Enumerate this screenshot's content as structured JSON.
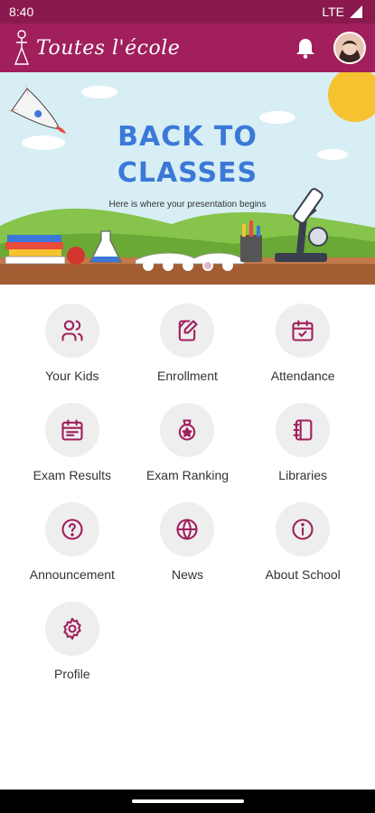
{
  "status": {
    "time": "8:40",
    "network": "LTE"
  },
  "app": {
    "logo_text": "Toutes l'école",
    "brand_color": "#a01f5c",
    "status_color": "#8a1a4e",
    "icon_color": "#a01f5c"
  },
  "banner": {
    "title_line1": "BACK TO",
    "title_line2": "CLASSES",
    "subtitle": "Here is where your presentation begins",
    "dot_count": 5,
    "active_dot": 4
  },
  "menu": [
    {
      "label": "Your Kids",
      "icon": "users-icon"
    },
    {
      "label": "Enrollment",
      "icon": "edit-document-icon"
    },
    {
      "label": "Attendance",
      "icon": "calendar-check-icon"
    },
    {
      "label": "Exam Results",
      "icon": "calendar-list-icon"
    },
    {
      "label": "Exam Ranking",
      "icon": "medal-icon"
    },
    {
      "label": "Libraries",
      "icon": "notebook-icon"
    },
    {
      "label": "Announcement",
      "icon": "help-circle-icon"
    },
    {
      "label": "News",
      "icon": "globe-icon"
    },
    {
      "label": "About School",
      "icon": "info-circle-icon"
    },
    {
      "label": "Profile",
      "icon": "settings-icon"
    }
  ]
}
